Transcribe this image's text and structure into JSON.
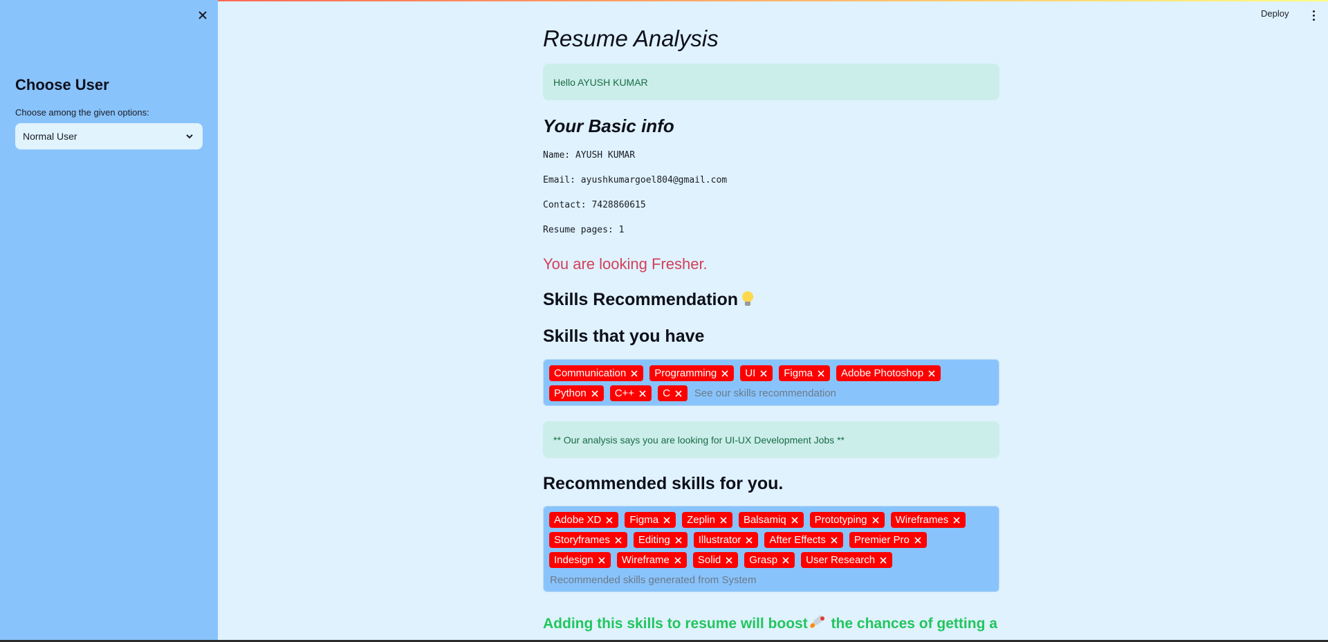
{
  "header": {
    "deploy_label": "Deploy"
  },
  "sidebar": {
    "title": "Choose User",
    "select_label": "Choose among the given options:",
    "select_value": "Normal User"
  },
  "main": {
    "title": "Resume Analysis",
    "hello": "Hello AYUSH KUMAR",
    "basic_info_title": "Your Basic info",
    "info": {
      "name": "Name: AYUSH KUMAR",
      "email": "Email: ayushkumargoel804@gmail.com",
      "contact": "Contact: 7428860615",
      "pages": "Resume pages: 1"
    },
    "level": "You are looking Fresher.",
    "skills_rec_title": "Skills Recommendation",
    "skills_have_title": "Skills that you have",
    "skills_have": [
      "Communication",
      "Programming",
      "UI",
      "Figma",
      "Adobe Photoshop",
      "Python",
      "C++",
      "C"
    ],
    "skills_have_placeholder": "See our skills recommendation",
    "analysis": "** Our analysis says you are looking for UI-UX Development Jobs **",
    "recommended_title": "Recommended skills for you.",
    "recommended": [
      "Adobe XD",
      "Figma",
      "Zeplin",
      "Balsamiq",
      "Prototyping",
      "Wireframes",
      "Storyframes",
      "Editing",
      "Illustrator",
      "After Effects",
      "Premier Pro",
      "Indesign",
      "Wireframe",
      "Solid",
      "Grasp",
      "User Research"
    ],
    "recommended_placeholder": "Recommended skills generated from System",
    "boost_pre": "Adding this skills to resume will boost",
    "boost_post": " the chances of getting a"
  },
  "icons": {
    "close": "close-icon",
    "chevron": "chevron-down-icon",
    "bulb": "lightbulb-icon",
    "rocket": "rocket-icon",
    "tag_remove": "close-icon"
  },
  "colors": {
    "sidebar_bg": "#89c3fb",
    "page_bg": "#dff2fd",
    "tag": "#ff0000",
    "fresher": "#d33f5a",
    "boost": "#22c55e",
    "alert_bg": "#cceeea",
    "alert_text": "#176b45"
  }
}
